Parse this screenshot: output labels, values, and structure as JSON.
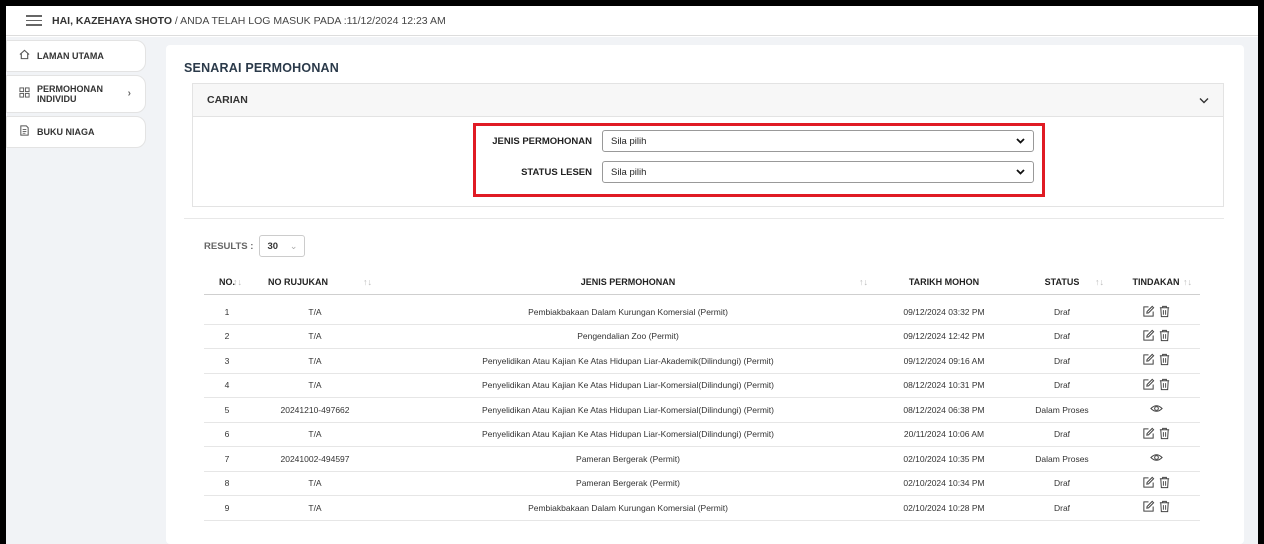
{
  "topbar": {
    "greeting": "HAI, KAZEHAYA SHOTO",
    "login_text": " / ANDA TELAH LOG MASUK PADA :11/12/2024 12:23 AM"
  },
  "sidebar": {
    "items": [
      {
        "label": "LAMAN UTAMA",
        "icon": "home-icon"
      },
      {
        "label_line1": "PERMOHONAN",
        "label_line2": "INDIVIDU",
        "icon": "grid-icon",
        "chevron": "›"
      },
      {
        "label": "BUKU NIAGA",
        "icon": "document-icon"
      }
    ]
  },
  "main": {
    "title": "SENARAI PERMOHONAN",
    "search": {
      "title": "CARIAN",
      "chevron": "⌄",
      "fields": [
        {
          "label": "JENIS PERMOHONAN",
          "value": "Sila pilih"
        },
        {
          "label": "STATUS LESEN",
          "value": "Sila pilih"
        }
      ]
    },
    "results": {
      "label": "RESULTS :",
      "value": "30"
    },
    "table": {
      "headers": [
        "NO.",
        "NO RUJUKAN",
        "JENIS PERMOHONAN",
        "TARIKH MOHON",
        "STATUS",
        "TINDAKAN"
      ],
      "rows": [
        {
          "no": "1",
          "ref": "T/A",
          "type": "Pembiakbakaan Dalam Kurungan Komersial (Permit)",
          "date": "09/12/2024 03:32 PM",
          "status": "Draf",
          "action": "edit-delete"
        },
        {
          "no": "2",
          "ref": "T/A",
          "type": "Pengendalian Zoo (Permit)",
          "date": "09/12/2024 12:42 PM",
          "status": "Draf",
          "action": "edit-delete"
        },
        {
          "no": "3",
          "ref": "T/A",
          "type": "Penyelidikan Atau Kajian Ke Atas Hidupan Liar-Akademik(Dilindungi) (Permit)",
          "date": "09/12/2024 09:16 AM",
          "status": "Draf",
          "action": "edit-delete"
        },
        {
          "no": "4",
          "ref": "T/A",
          "type": "Penyelidikan Atau Kajian Ke Atas Hidupan Liar-Komersial(Dilindungi) (Permit)",
          "date": "08/12/2024 10:31 PM",
          "status": "Draf",
          "action": "edit-delete"
        },
        {
          "no": "5",
          "ref": "20241210-497662",
          "type": "Penyelidikan Atau Kajian Ke Atas Hidupan Liar-Komersial(Dilindungi) (Permit)",
          "date": "08/12/2024 06:38 PM",
          "status": "Dalam Proses",
          "action": "view"
        },
        {
          "no": "6",
          "ref": "T/A",
          "type": "Penyelidikan Atau Kajian Ke Atas Hidupan Liar-Komersial(Dilindungi) (Permit)",
          "date": "20/11/2024 10:06 AM",
          "status": "Draf",
          "action": "edit-delete"
        },
        {
          "no": "7",
          "ref": "20241002-494597",
          "type": "Pameran Bergerak (Permit)",
          "date": "02/10/2024 10:35 PM",
          "status": "Dalam Proses",
          "action": "view"
        },
        {
          "no": "8",
          "ref": "T/A",
          "type": "Pameran Bergerak (Permit)",
          "date": "02/10/2024 10:34 PM",
          "status": "Draf",
          "action": "edit-delete"
        },
        {
          "no": "9",
          "ref": "T/A",
          "type": "Pembiakbakaan Dalam Kurungan Komersial (Permit)",
          "date": "02/10/2024 10:28 PM",
          "status": "Draf",
          "action": "edit-delete"
        }
      ]
    }
  },
  "colors": {
    "highlight": "#e01b24",
    "background": "#f1f3f6"
  }
}
